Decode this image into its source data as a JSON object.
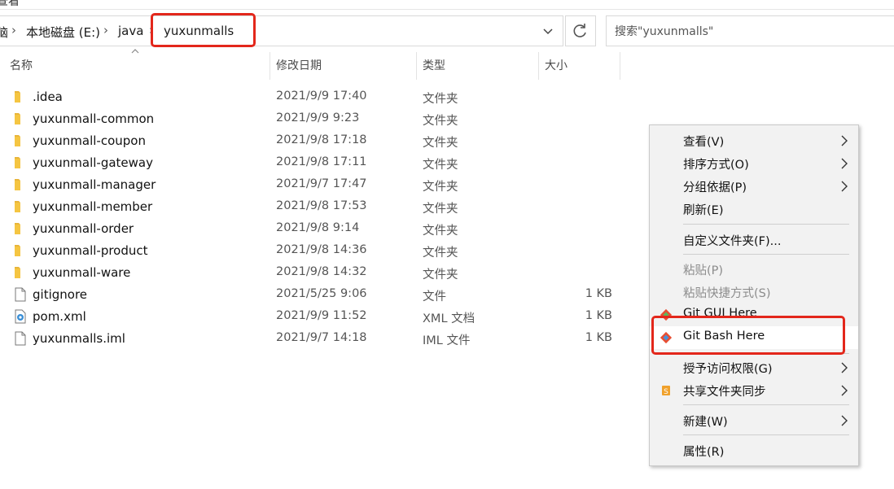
{
  "window": {
    "menu_fragment": "查看"
  },
  "address": {
    "crumbs": [
      "此电脑",
      "本地磁盘 (E:)",
      "java",
      "yuxunmalls"
    ],
    "crumb_first_visible": "脑"
  },
  "search": {
    "placeholder": "搜索\"yuxunmalls\""
  },
  "columns": {
    "name": "名称",
    "date": "修改日期",
    "type": "类型",
    "size": "大小"
  },
  "files": [
    {
      "name": ".idea",
      "date": "2021/9/9 17:40",
      "type": "文件夹",
      "size": "",
      "icon": "folder-icon"
    },
    {
      "name": "yuxunmall-common",
      "date": "2021/9/9 9:23",
      "type": "文件夹",
      "size": "",
      "icon": "folder-icon"
    },
    {
      "name": "yuxunmall-coupon",
      "date": "2021/9/8 17:18",
      "type": "文件夹",
      "size": "",
      "icon": "folder-icon"
    },
    {
      "name": "yuxunmall-gateway",
      "date": "2021/9/8 17:11",
      "type": "文件夹",
      "size": "",
      "icon": "folder-icon"
    },
    {
      "name": "yuxunmall-manager",
      "date": "2021/9/7 17:47",
      "type": "文件夹",
      "size": "",
      "icon": "folder-icon"
    },
    {
      "name": "yuxunmall-member",
      "date": "2021/9/8 17:53",
      "type": "文件夹",
      "size": "",
      "icon": "folder-icon"
    },
    {
      "name": "yuxunmall-order",
      "date": "2021/9/8 9:14",
      "type": "文件夹",
      "size": "",
      "icon": "folder-icon"
    },
    {
      "name": "yuxunmall-product",
      "date": "2021/9/8 14:36",
      "type": "文件夹",
      "size": "",
      "icon": "folder-icon"
    },
    {
      "name": "yuxunmall-ware",
      "date": "2021/9/8 14:32",
      "type": "文件夹",
      "size": "",
      "icon": "folder-icon"
    },
    {
      "name": "gitignore",
      "date": "2021/5/25 9:06",
      "type": "文件",
      "size": "1 KB",
      "icon": "file-icon"
    },
    {
      "name": "pom.xml",
      "date": "2021/9/9 11:52",
      "type": "XML 文档",
      "size": "1 KB",
      "icon": "xml-file-icon"
    },
    {
      "name": "yuxunmalls.iml",
      "date": "2021/9/7 14:18",
      "type": "IML 文件",
      "size": "1 KB",
      "icon": "file-icon"
    }
  ],
  "context_menu": {
    "view": "查看(V)",
    "sort_by": "排序方式(O)",
    "group_by": "分组依据(P)",
    "refresh": "刷新(E)",
    "customize_folder": "自定义文件夹(F)...",
    "paste": "粘贴(P)",
    "paste_shortcut": "粘贴快捷方式(S)",
    "git_gui": "Git GUI Here",
    "git_bash": "Git Bash Here",
    "give_access": "授予访问权限(G)",
    "sync_shared": "共享文件夹同步",
    "new": "新建(W)",
    "properties": "属性(R)"
  },
  "colors": {
    "highlight_box": "#e3271b",
    "folder": "#f5c542",
    "menu_bg": "#f2f2f2"
  }
}
